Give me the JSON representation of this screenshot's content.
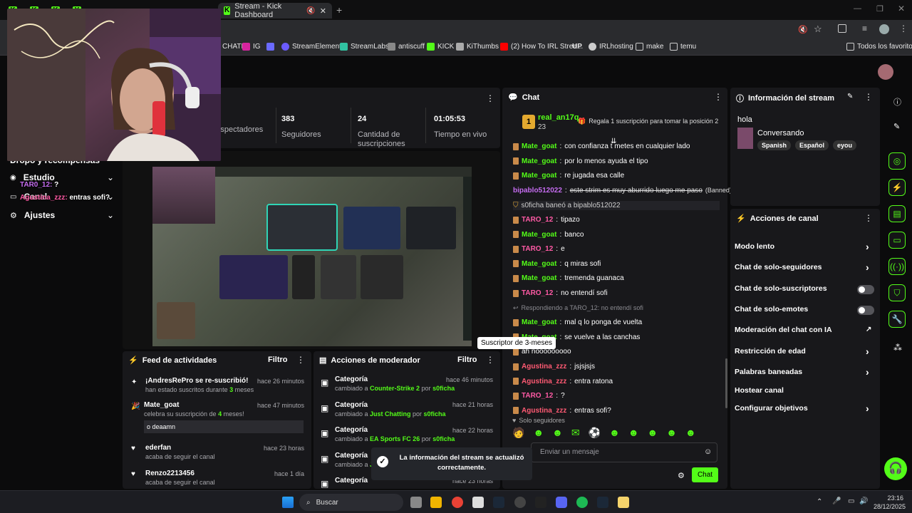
{
  "browser": {
    "tabs": [
      {
        "label": "K"
      },
      {
        "label": "K"
      },
      {
        "label": "K"
      },
      {
        "label": "Y"
      },
      {
        "label": "Stream - Kick Dashboard"
      }
    ],
    "active_tab": "Stream - Kick Dashboard",
    "bookmarks": [
      {
        "label": "CHATI"
      },
      {
        "label": "IG"
      },
      {
        "label": ""
      },
      {
        "label": "StreamElements"
      },
      {
        "label": "StreamLabs"
      },
      {
        "label": "antiscuff"
      },
      {
        "label": "KICK"
      },
      {
        "label": "KiThumbs"
      },
      {
        "label": "(2) How To IRL Strea..."
      },
      {
        "label": "UP"
      },
      {
        "label": "IRLhosting"
      },
      {
        "label": "make"
      },
      {
        "label": "temu"
      }
    ],
    "all_bookmarks": "Todos los favoritos"
  },
  "sidebar": {
    "items": [
      {
        "label": "Dropo y recompensas"
      },
      {
        "label": "Estudio"
      },
      {
        "label": "Canal"
      },
      {
        "label": "Ajustes"
      }
    ],
    "overlay_chat": [
      {
        "user": "TAR0_12:",
        "msg": "?"
      },
      {
        "user": "Agustina_zzz:",
        "msg": "entras sofi?"
      }
    ]
  },
  "stats": [
    {
      "value": "",
      "label": "Espectadores"
    },
    {
      "value": "383",
      "label": "Seguidores"
    },
    {
      "value": "24",
      "label": "Cantidad de suscripciones"
    },
    {
      "value": "01:05:53",
      "label": "Tiempo en vivo"
    }
  ],
  "activity_feed": {
    "title": "Feed de actividades",
    "filter": "Filtro",
    "items": [
      {
        "title": "¡AndresRePro se re-suscribió!",
        "time": "hace 26 minutos",
        "sub_pre": "han estado suscritos durante ",
        "sub_bold": "3",
        "sub_post": " meses"
      },
      {
        "title": "Mate_goat",
        "time": "hace 47 minutos",
        "sub_pre": "celebra su suscripción de ",
        "sub_bold": "4",
        "sub_post": " meses!",
        "quote": "o deaamn"
      },
      {
        "title": "ederfan",
        "time": "hace 23 horas",
        "sub_pre": "acaba de seguir el canal",
        "sub_bold": "",
        "sub_post": ""
      },
      {
        "title": "Renzo2213456",
        "time": "hace 1 día",
        "sub_pre": "acaba de seguir el canal",
        "sub_bold": "",
        "sub_post": ""
      }
    ]
  },
  "mod_actions": {
    "title": "Acciones de moderador",
    "filter": "Filtro",
    "items": [
      {
        "title": "Categoría",
        "time": "hace 46 minutos",
        "pre": "cambiado a ",
        "cat": "Counter-Strike 2",
        "by": " por ",
        "user": "s0ficha"
      },
      {
        "title": "Categoría",
        "time": "hace 21 horas",
        "pre": "cambiado a ",
        "cat": "Just Chatting",
        "by": " por ",
        "user": "s0ficha"
      },
      {
        "title": "Categoría",
        "time": "hace 22 horas",
        "pre": "cambiado a ",
        "cat": "EA Sports FC 26",
        "by": " por ",
        "user": "s0ficha"
      },
      {
        "title": "Categoría",
        "time": "",
        "pre": "cambiado a ",
        "cat": "J",
        "by": "",
        "user": ""
      },
      {
        "title": "Categoría",
        "time": "hace 23 horas",
        "pre": "",
        "cat": "",
        "by": "",
        "user": ""
      }
    ]
  },
  "toast": {
    "line1": "La información del stream se actualizó",
    "line2": "correctamente."
  },
  "tooltip": "Suscriptor de 3-meses",
  "chat": {
    "title": "Chat",
    "top_gifter": {
      "rank": "1",
      "name": "real_an17q",
      "count": "23",
      "cta": "Regala 1 suscripción para tomar la posición 2"
    },
    "messages": [
      {
        "user": "Mate_goat",
        "cls": "u-mate",
        "text": "con confianza t metes en cualquier lado"
      },
      {
        "user": "Mate_goat",
        "cls": "u-mate",
        "text": "por lo menos ayuda el tipo"
      },
      {
        "user": "Mate_goat",
        "cls": "u-mate",
        "text": "re jugada esa calle"
      },
      {
        "user": "bipablo512022",
        "cls": "u-bip",
        "text": "este strim es muy aburrido luego me paso",
        "extra": "(Banned)"
      },
      {
        "system": "s0ficha baneó a bipablo512022"
      },
      {
        "user": "TARO_12",
        "cls": "u-taro",
        "text": "tipazo"
      },
      {
        "user": "Mate_goat",
        "cls": "u-mate",
        "text": "banco"
      },
      {
        "user": "TARO_12",
        "cls": "u-taro",
        "text": "e"
      },
      {
        "user": "Mate_goat",
        "cls": "u-mate",
        "text": "q miras sofi"
      },
      {
        "user": "Mate_goat",
        "cls": "u-mate",
        "text": "tremenda guanaca"
      },
      {
        "user": "TARO_12",
        "cls": "u-taro",
        "text": "no entendí sofi"
      },
      {
        "reply": "Respondiendo a TARO_12: no entendí sofi"
      },
      {
        "user": "Mate_goat",
        "cls": "u-mate",
        "text": "mal q lo ponga de vuelta"
      },
      {
        "user": "Mate_goat",
        "cls": "u-mate",
        "text": "se vuelve a las canchas"
      },
      {
        "user": "",
        "cls": "u-mate",
        "text": "ah nooooooooo"
      },
      {
        "user": "Agustina_zzz",
        "cls": "u-agus",
        "text": "jsjsjsjs"
      },
      {
        "user": "Agustina_zzz",
        "cls": "u-agus",
        "text": "entra ratona"
      },
      {
        "user": "TARO_12",
        "cls": "u-taro",
        "text": "?"
      },
      {
        "user": "Agustina_zzz",
        "cls": "u-agus",
        "text": "entras sofi?"
      }
    ],
    "followers_only": "Solo seguidores",
    "input_placeholder": "Enviar un mensaje",
    "send": "Chat"
  },
  "stream_info": {
    "title": "Información del stream",
    "stream_title": "hola",
    "category": "Conversando",
    "tags": [
      "Spanish",
      "Español",
      "eyou"
    ]
  },
  "channel_actions": {
    "title": "Acciones de canal",
    "items": [
      {
        "label": "Modo lento",
        "ctl": "chev"
      },
      {
        "label": "Chat de solo-seguidores",
        "ctl": "chev"
      },
      {
        "label": "Chat de solo-suscriptores",
        "ctl": "toggle"
      },
      {
        "label": "Chat de solo-emotes",
        "ctl": "toggle"
      },
      {
        "label": "Moderación del chat con IA",
        "ctl": "ext"
      },
      {
        "label": "Restricción de edad",
        "ctl": "chev"
      },
      {
        "label": "Palabras baneadas",
        "ctl": "chev"
      },
      {
        "label": "Hostear canal",
        "ctl": ""
      },
      {
        "label": "Configurar objetivos",
        "ctl": "chev"
      }
    ]
  },
  "taskbar": {
    "search": "Buscar",
    "time": "23:16",
    "date": "28/12/2025"
  },
  "colors": {
    "accent": "#53fc18",
    "panel": "#18181b",
    "bg": "#0b0b0c"
  }
}
